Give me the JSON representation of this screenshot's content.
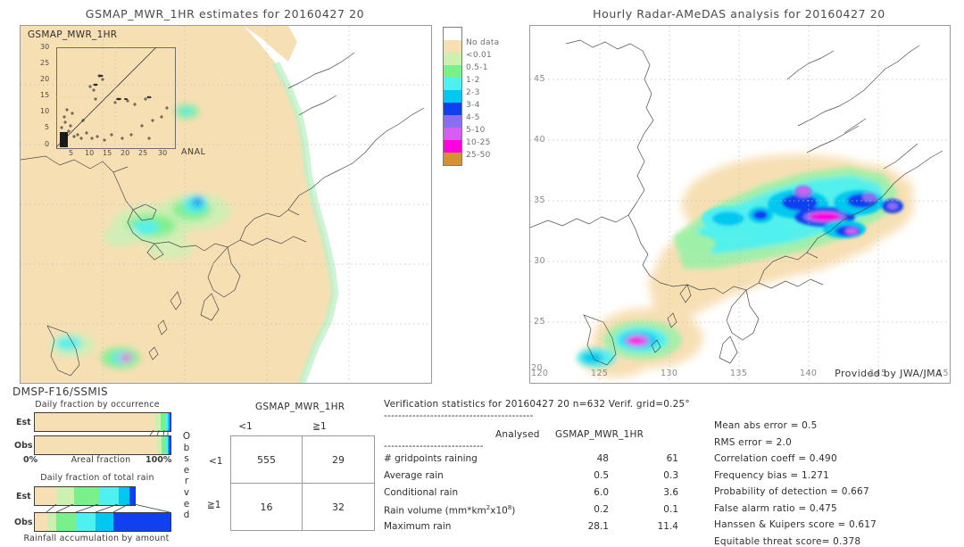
{
  "left_panel": {
    "title": "GSMAP_MWR_1HR estimates for 20160427 20",
    "inset_title": "GSMAP_MWR_1HR",
    "inset_anal_label": "ANAL",
    "inset_y_ticks": [
      "30",
      "25",
      "20",
      "15",
      "10",
      "5",
      "0"
    ],
    "inset_x_ticks": [
      "5",
      "10",
      "15",
      "20",
      "25",
      "30"
    ],
    "sensor_label": "DMSP-F16/SSMIS"
  },
  "right_panel": {
    "title": "Hourly Radar-AMeDAS analysis for 20160427 20",
    "provided_by": "Provided by JWA/JMA",
    "x_ticks": [
      "120",
      "125",
      "130",
      "135",
      "140",
      "145",
      "15"
    ],
    "y_ticks": [
      "45",
      "40",
      "35",
      "30",
      "25",
      "20"
    ]
  },
  "colorbar": {
    "entries": [
      {
        "label": "",
        "color": "#ffffff"
      },
      {
        "label": "No data",
        "color": "#f7dfb4"
      },
      {
        "label": "<0.01",
        "color": "#ccf0b0"
      },
      {
        "label": "0.5-1",
        "color": "#7af08a"
      },
      {
        "label": "1-2",
        "color": "#4ff0f0"
      },
      {
        "label": "2-3",
        "color": "#00c8f0"
      },
      {
        "label": "3-4",
        "color": "#1040f0"
      },
      {
        "label": "4-5",
        "color": "#8a6ef0"
      },
      {
        "label": "5-10",
        "color": "#d45ef0"
      },
      {
        "label": "10-25",
        "color": "#ff00e0"
      },
      {
        "label": "25-50",
        "color": "#d69232"
      }
    ]
  },
  "occurrence_chart": {
    "title": "Daily fraction by occurrence",
    "row1_label": "Est",
    "row2_label": "Obs",
    "axis_left": "0%",
    "axis_center": "Areal fraction",
    "axis_right": "100%",
    "est_segments": [
      {
        "color": "#f7dfb4",
        "pct": 88.5
      },
      {
        "color": "#ccf0b0",
        "pct": 4.0
      },
      {
        "color": "#7af08a",
        "pct": 4.0
      },
      {
        "color": "#4ff0f0",
        "pct": 1.8
      },
      {
        "color": "#00c8f0",
        "pct": 1.0
      },
      {
        "color": "#1040f0",
        "pct": 0.7
      }
    ],
    "obs_segments": [
      {
        "color": "#f7dfb4",
        "pct": 90.0
      },
      {
        "color": "#ccf0b0",
        "pct": 3.2
      },
      {
        "color": "#7af08a",
        "pct": 3.0
      },
      {
        "color": "#4ff0f0",
        "pct": 1.6
      },
      {
        "color": "#00c8f0",
        "pct": 1.2
      },
      {
        "color": "#1040f0",
        "pct": 1.0
      }
    ]
  },
  "amount_chart": {
    "title": "Daily fraction of total rain",
    "row1_label": "Est",
    "row2_label": "Obs",
    "caption": "Rainfall accumulation by amount",
    "est_segments": [
      {
        "color": "#f7dfb4",
        "pct": 22.0
      },
      {
        "color": "#ccf0b0",
        "pct": 17.0
      },
      {
        "color": "#7af08a",
        "pct": 25.0
      },
      {
        "color": "#4ff0f0",
        "pct": 20.0
      },
      {
        "color": "#00c8f0",
        "pct": 11.0
      },
      {
        "color": "#1040f0",
        "pct": 5.0
      }
    ],
    "obs_segments": [
      {
        "color": "#f7dfb4",
        "pct": 9.0
      },
      {
        "color": "#ccf0b0",
        "pct": 7.0
      },
      {
        "color": "#7af08a",
        "pct": 15.0
      },
      {
        "color": "#4ff0f0",
        "pct": 14.0
      },
      {
        "color": "#00c8f0",
        "pct": 13.0
      },
      {
        "color": "#1040f0",
        "pct": 42.0
      }
    ]
  },
  "contingency": {
    "title": "GSMAP_MWR_1HR",
    "col_headers": [
      "<1",
      "≧1"
    ],
    "row_headers": [
      "<1",
      "≧1"
    ],
    "observed_label": "Observed",
    "cells": [
      [
        "555",
        "29"
      ],
      [
        "16",
        "32"
      ]
    ]
  },
  "verification": {
    "header": "Verification statistics for 20160427 20  n=632  Verif. grid=0.25°",
    "divider": "------------------------------------------",
    "col_analysed": "Analysed",
    "col_product": "GSMAP_MWR_1HR",
    "divider2": "----------------------------",
    "rows": [
      {
        "name": "# gridpoints raining",
        "analysed": "48",
        "product": "61"
      },
      {
        "name": "Average rain",
        "analysed": "0.5",
        "product": "0.3"
      },
      {
        "name": "Conditional rain",
        "analysed": "6.0",
        "product": "3.6"
      },
      {
        "name": "Rain volume (mm*km²x10⁸)",
        "analysed": "0.2",
        "product": "0.1"
      },
      {
        "name": "Maximum rain",
        "analysed": "28.1",
        "product": "11.4"
      }
    ]
  },
  "scores": [
    "Mean abs error = 0.5",
    "RMS error = 2.0",
    "Correlation coeff = 0.490",
    "Frequency bias = 1.271",
    "Probability of detection = 0.667",
    "False alarm ratio = 0.475",
    "Hanssen & Kuipers score = 0.617",
    "Equitable threat score= 0.378"
  ]
}
